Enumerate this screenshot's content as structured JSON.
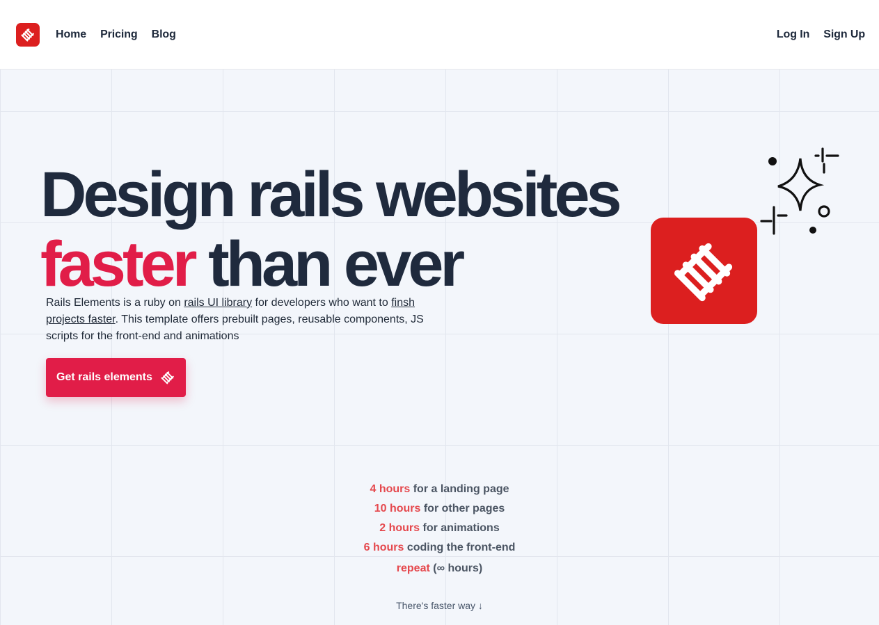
{
  "nav": {
    "logo_alt": "Rails Elements",
    "links": [
      "Home",
      "Pricing",
      "Blog"
    ],
    "login": "Log In",
    "signup": "Sign Up"
  },
  "hero": {
    "headline_line1": "Design rails websites",
    "headline_accent": "faster",
    "headline_rest": " than ever",
    "desc_part1": "Rails Elements is a ruby on ",
    "desc_link1": "rails UI library",
    "desc_part2": " for developers who want to ",
    "desc_link2": "finsh projects faster",
    "desc_part3": ". This template offers prebuilt pages, reusable components, JS scripts for the front-end and animations",
    "cta_label": "Get rails elements"
  },
  "stats": [
    {
      "highlight": "4 hours",
      "text": " for a landing page"
    },
    {
      "highlight": "10 hours",
      "text": " for other pages"
    },
    {
      "highlight": "2 hours",
      "text": " for animations"
    },
    {
      "highlight": "6 hours",
      "text": " coding the front-end"
    },
    {
      "highlight": "repeat",
      "text": " (∞ hours)"
    }
  ],
  "faster_way": "There's faster way ↓",
  "colors": {
    "brand_red": "#dc1f1f",
    "accent_pink": "#e11d48",
    "stat_highlight": "#e5484d",
    "heading": "#1f2a3d"
  }
}
